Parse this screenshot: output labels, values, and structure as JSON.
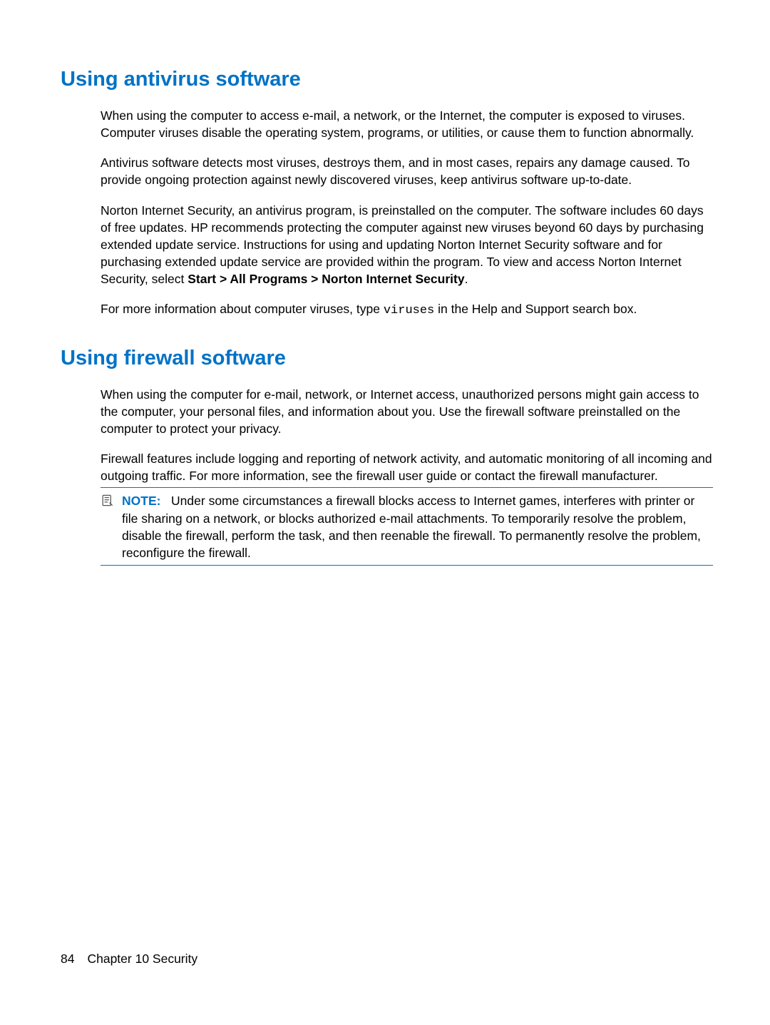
{
  "section1": {
    "heading": "Using antivirus software",
    "p1": "When using the computer to access e-mail, a network, or the Internet, the computer is exposed to viruses. Computer viruses disable the operating system, programs, or utilities, or cause them to function abnormally.",
    "p2": "Antivirus software detects most viruses, destroys them, and in most cases, repairs any damage caused. To provide ongoing protection against newly discovered viruses, keep antivirus software up-to-date.",
    "p3_pre": "Norton Internet Security, an antivirus program, is preinstalled on the computer. The software includes 60 days of free updates. HP recommends protecting the computer against new viruses beyond 60 days by purchasing extended update service. Instructions for using and updating Norton Internet Security software and for purchasing extended update service are provided within the program. To view and access Norton Internet Security, select ",
    "p3_bold": "Start > All Programs > Norton Internet Security",
    "p3_post": ".",
    "p4_pre": "For more information about computer viruses, type ",
    "p4_code": "viruses",
    "p4_post": " in the Help and Support search box."
  },
  "section2": {
    "heading": "Using firewall software",
    "p1": "When using the computer for e-mail, network, or Internet access, unauthorized persons might gain access to the computer, your personal files, and information about you. Use the firewall software preinstalled on the computer to protect your privacy.",
    "p2": "Firewall features include logging and reporting of network activity, and automatic monitoring of all incoming and outgoing traffic. For more information, see the firewall user guide or contact the firewall manufacturer.",
    "note_label": "NOTE:",
    "note_body": "Under some circumstances a firewall blocks access to Internet games, interferes with printer or file sharing on a network, or blocks authorized e-mail attachments. To temporarily resolve the problem, disable the firewall, perform the task, and then reenable the firewall. To permanently resolve the problem, reconfigure the firewall."
  },
  "footer": {
    "page_number": "84",
    "chapter_label": "Chapter 10   Security"
  }
}
